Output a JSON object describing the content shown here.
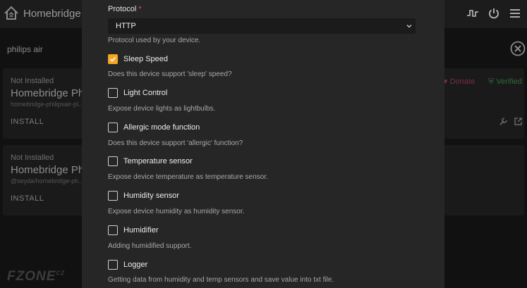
{
  "app": {
    "title": "Homebridge"
  },
  "search": {
    "value": "philips air"
  },
  "cards": [
    {
      "status": "Not Installed",
      "name": "Homebridge Ph",
      "package": "homebridge-philipsair-pl...",
      "install_label": "INSTALL",
      "donate_label": "Donate",
      "verified_label": "Verified"
    },
    {
      "status": "Not Installed",
      "name": "Homebridge Ph",
      "package": "@seyda/homebridge-ph...",
      "install_label": "INSTALL"
    }
  ],
  "watermark": {
    "text": "FZONE",
    "suffix": "CZ"
  },
  "modal": {
    "protocol": {
      "label": "Protocol",
      "required_mark": "*",
      "value": "HTTP",
      "help": "Protocol used by your device."
    },
    "options": [
      {
        "label": "Sleep Speed",
        "checked": true,
        "help": "Does this device support 'sleep' speed?"
      },
      {
        "label": "Light Control",
        "checked": false,
        "help": "Expose device lights as lightbulbs."
      },
      {
        "label": "Allergic mode function",
        "checked": false,
        "help": "Does this device support 'allergic' function?"
      },
      {
        "label": "Temperature sensor",
        "checked": false,
        "help": "Expose device temperature as temperature sensor."
      },
      {
        "label": "Humidity sensor",
        "checked": false,
        "help": "Expose device humidity as humidity sensor."
      },
      {
        "label": "Humidifier",
        "checked": false,
        "help": "Adding humidified support."
      },
      {
        "label": "Logger",
        "checked": false,
        "help": "Getting data from humidity and temp sensors and save value into txt file."
      }
    ]
  },
  "colors": {
    "accent": "#f5a623",
    "required": "#d9534f",
    "modal_bg": "#262626"
  }
}
